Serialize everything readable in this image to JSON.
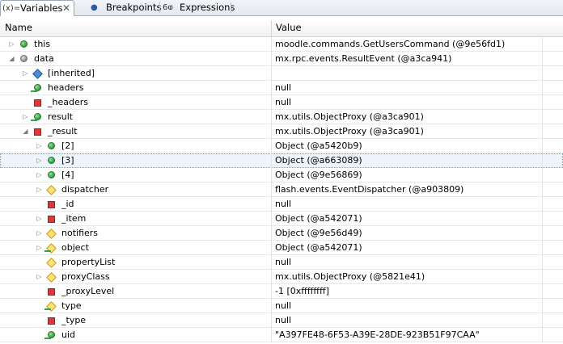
{
  "tabs": [
    {
      "icon": "variables-icon",
      "icon_text": "(x)=",
      "label": "Variables",
      "active": true
    },
    {
      "icon": "breakpoints-icon",
      "icon_text": "●",
      "label": "Breakpoints",
      "active": false
    },
    {
      "icon": "expressions-icon",
      "icon_text": "6ⱷ",
      "label": "Expressions",
      "active": false
    }
  ],
  "columns": {
    "name": "Name",
    "value": "Value"
  },
  "rows": [
    {
      "name": "this",
      "value": "moodle.commands.GetUsersCommand (@9e56fd1)",
      "icon": "green-circle",
      "twisty": "collapsed"
    },
    {
      "name": "data",
      "value": "mx.rpc.events.ResultEvent (@a3ca941)",
      "icon": "gray-circle",
      "twisty": "expanded"
    },
    {
      "name": "[inherited]",
      "value": "",
      "icon": "blue-diamond",
      "twisty": "collapsed"
    },
    {
      "name": "headers",
      "value": "null",
      "icon": "green-circle-accessor",
      "twisty": "none"
    },
    {
      "name": "_headers",
      "value": "null",
      "icon": "red-square",
      "twisty": "none"
    },
    {
      "name": "result",
      "value": "mx.utils.ObjectProxy (@a3ca901)",
      "icon": "green-circle-accessor",
      "twisty": "collapsed"
    },
    {
      "name": "_result",
      "value": "mx.utils.ObjectProxy (@a3ca901)",
      "icon": "red-square",
      "twisty": "expanded"
    },
    {
      "name": "[2]",
      "value": "Object (@a5420b9)",
      "icon": "green-circle",
      "twisty": "collapsed"
    },
    {
      "name": "[3]",
      "value": "Object (@a663089)",
      "icon": "green-circle",
      "twisty": "collapsed",
      "selected": true
    },
    {
      "name": "[4]",
      "value": "Object (@9e56869)",
      "icon": "green-circle",
      "twisty": "collapsed"
    },
    {
      "name": "dispatcher",
      "value": "flash.events.EventDispatcher (@a903809)",
      "icon": "yellow-diamond",
      "twisty": "collapsed"
    },
    {
      "name": "_id",
      "value": "null",
      "icon": "red-square",
      "twisty": "none"
    },
    {
      "name": "_item",
      "value": "Object (@a542071)",
      "icon": "red-square",
      "twisty": "collapsed"
    },
    {
      "name": "notifiers",
      "value": "Object (@9e56d49)",
      "icon": "yellow-diamond",
      "twisty": "collapsed"
    },
    {
      "name": "object",
      "value": "Object (@a542071)",
      "icon": "yellow-diamond-accessor",
      "twisty": "collapsed"
    },
    {
      "name": "propertyList",
      "value": "null",
      "icon": "yellow-diamond",
      "twisty": "none"
    },
    {
      "name": "proxyClass",
      "value": "mx.utils.ObjectProxy (@5821e41)",
      "icon": "yellow-diamond",
      "twisty": "collapsed"
    },
    {
      "name": "_proxyLevel",
      "value": "-1 [0xffffffff]",
      "icon": "red-square",
      "twisty": "none"
    },
    {
      "name": "type",
      "value": "null",
      "icon": "yellow-diamond-accessor",
      "twisty": "none"
    },
    {
      "name": "_type",
      "value": "null",
      "icon": "red-square",
      "twisty": "none"
    },
    {
      "name": "uid",
      "value": "\"A397FE48-6F53-A39E-28DE-923B51F97CAA\"",
      "icon": "green-circle-accessor",
      "twisty": "none"
    }
  ]
}
